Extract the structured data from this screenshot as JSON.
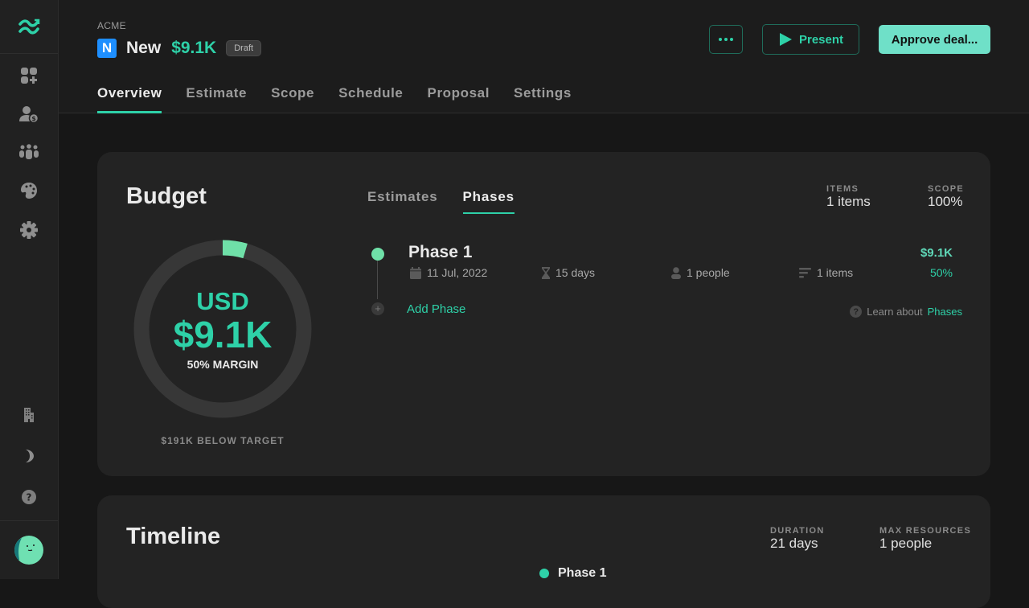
{
  "sidebar": {
    "top_items": [
      {
        "icon": "dashboard-add-icon",
        "label": "Dashboard"
      },
      {
        "icon": "client-billing-icon",
        "label": "Clients"
      },
      {
        "icon": "team-icon",
        "label": "Team"
      },
      {
        "icon": "palette-icon",
        "label": "Branding"
      },
      {
        "icon": "gear-icon",
        "label": "Settings"
      }
    ],
    "bottom_items": [
      {
        "icon": "building-icon",
        "label": "Company"
      },
      {
        "icon": "moon-icon",
        "label": "Dark mode"
      },
      {
        "icon": "help-icon",
        "label": "Help"
      }
    ]
  },
  "header": {
    "company": "ACME",
    "badge_letter": "N",
    "deal_name": "New",
    "deal_value": "$9.1K",
    "status": "Draft",
    "present_label": "Present",
    "approve_label": "Approve deal...",
    "tabs": [
      {
        "label": "Overview",
        "active": true
      },
      {
        "label": "Estimate",
        "active": false
      },
      {
        "label": "Scope",
        "active": false
      },
      {
        "label": "Schedule",
        "active": false
      },
      {
        "label": "Proposal",
        "active": false
      },
      {
        "label": "Settings",
        "active": false
      }
    ]
  },
  "budget": {
    "title": "Budget",
    "currency": "USD",
    "amount": "$9.1K",
    "margin": "50% MARGIN",
    "progress_fraction": 0.045,
    "below_target": "$191K BELOW TARGET",
    "subtabs": [
      {
        "label": "Estimates",
        "active": false
      },
      {
        "label": "Phases",
        "active": true
      }
    ],
    "stats": [
      {
        "label": "ITEMS",
        "value": "1 items"
      },
      {
        "label": "SCOPE",
        "value": "100%"
      }
    ],
    "phases": [
      {
        "name": "Phase 1",
        "date": "11 Jul, 2022",
        "duration": "15 days",
        "people": "1 people",
        "items": "1 items",
        "amount": "$9.1K",
        "margin": "50%"
      }
    ],
    "add_phase_label": "Add Phase",
    "learn_prefix": "Learn about",
    "learn_link": "Phases"
  },
  "timeline": {
    "title": "Timeline",
    "stats": [
      {
        "label": "DURATION",
        "value": "21 days"
      },
      {
        "label": "MAX RESOURCES",
        "value": "1 people"
      }
    ],
    "legend": [
      "Phase 1"
    ]
  },
  "colors": {
    "accent": "#2ed1a8",
    "accent_light": "#6fe0c8",
    "phase_dot": "#6fe0a8",
    "badge_blue": "#1e8fff"
  }
}
